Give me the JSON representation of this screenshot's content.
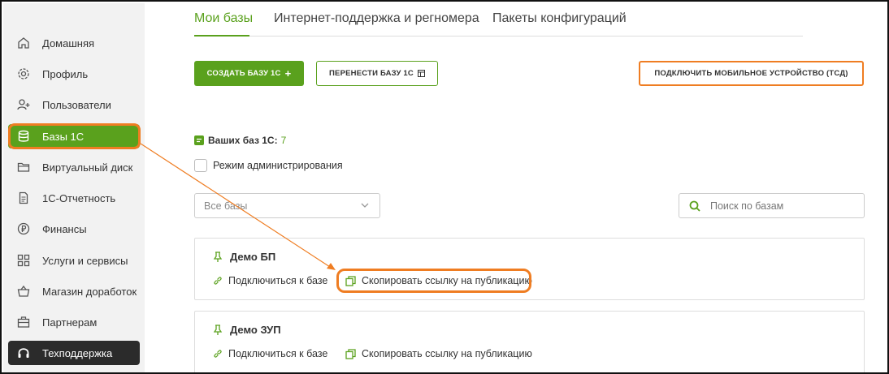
{
  "sidebar": {
    "items": [
      {
        "label": "Домашняя",
        "icon": "home-icon"
      },
      {
        "label": "Профиль",
        "icon": "gear-icon"
      },
      {
        "label": "Пользователи",
        "icon": "add-user-icon"
      },
      {
        "label": "Базы 1С",
        "icon": "database-icon"
      },
      {
        "label": "Виртуальный диск",
        "icon": "folder-icon"
      },
      {
        "label": "1С-Отчетность",
        "icon": "document-icon"
      },
      {
        "label": "Финансы",
        "icon": "ruble-icon"
      },
      {
        "label": "Услуги и сервисы",
        "icon": "grid-icon"
      },
      {
        "label": "Магазин доработок",
        "icon": "basket-icon"
      },
      {
        "label": "Партнерам",
        "icon": "briefcase-icon"
      },
      {
        "label": "Техподдержка",
        "icon": "headset-icon"
      }
    ]
  },
  "tabs": [
    {
      "label": "Мои базы"
    },
    {
      "label": "Интернет-поддержка и регномера"
    },
    {
      "label": "Пакеты конфигураций"
    }
  ],
  "toolbar": {
    "create_label": "СОЗДАТЬ БАЗУ 1С",
    "transfer_label": "ПЕРЕНЕСТИ БАЗУ 1С",
    "mobile_label": "ПОДКЛЮЧИТЬ МОБИЛЬНОЕ УСТРОЙСТВО (ТСД)"
  },
  "bases_count": {
    "label": "Ваших баз 1С:",
    "value": "7"
  },
  "admin_mode_label": "Режим администрирования",
  "filter": {
    "selected": "Все базы"
  },
  "search": {
    "placeholder": "Поиск по базам"
  },
  "cards": [
    {
      "title": "Демо БП",
      "connect_label": "Подключиться к базе",
      "copy_label": "Скопировать ссылку на публикацию"
    },
    {
      "title": "Демо ЗУП",
      "connect_label": "Подключиться к базе",
      "copy_label": "Скопировать ссылку на публикацию"
    }
  ],
  "colors": {
    "accent": "#5aa11d",
    "highlight": "#ef7d22",
    "support_bg": "#2b2b2b"
  }
}
